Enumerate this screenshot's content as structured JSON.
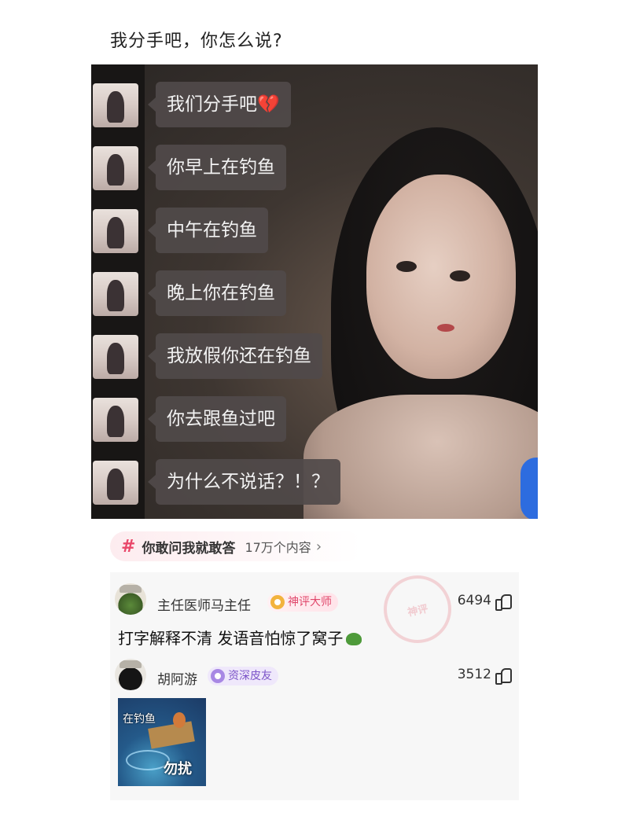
{
  "post": {
    "title": "我分手吧，你怎么说?"
  },
  "chat_image": {
    "messages": [
      "我们分手吧💔",
      "你早上在钓鱼",
      "中午在钓鱼",
      "晚上你在钓鱼",
      "我放假你还在钓鱼",
      "你去跟鱼过吧",
      "为什么不说话？！？"
    ]
  },
  "topic": {
    "icon": "hash-icon",
    "name": "你敢问我就敢答",
    "count": "17万个内容",
    "arrow": "›"
  },
  "comments": [
    {
      "user": "主任医师马主任",
      "badge": "神评大师",
      "likes": "6494",
      "text": "打字解释不清 发语音怕惊了窝子"
    },
    {
      "user": "胡阿游",
      "badge": "资深皮友",
      "likes": "3512",
      "sticker": {
        "top_text": "在钓鱼",
        "bottom_text": "勿扰"
      }
    }
  ],
  "colors": {
    "accent_pink": "#e9486a",
    "badge_purple": "#7c55c8",
    "chat_bubble": "#504a4a"
  }
}
